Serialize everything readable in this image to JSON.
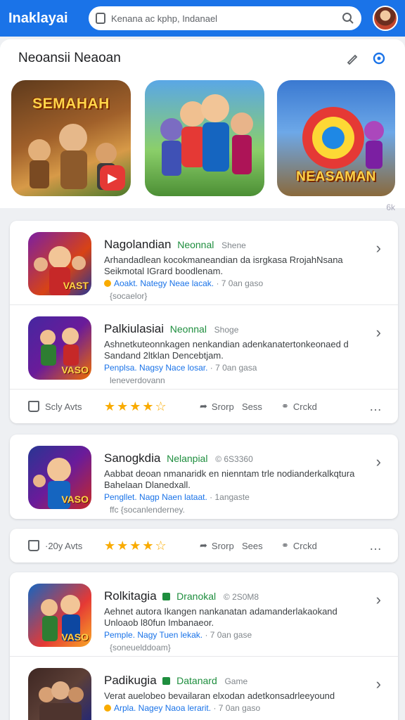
{
  "header": {
    "brand": "Inaklayai",
    "search_placeholder": "Kenana ac kphp, Indanael"
  },
  "featured": {
    "title": "Neoansii Neaoan",
    "banners": [
      {
        "caption": "SEMAHAH",
        "colors": [
          "#7a4a22",
          "#c98a3e"
        ]
      },
      {
        "caption": "",
        "colors": [
          "#3aa0e8",
          "#69b64a"
        ]
      },
      {
        "caption": "NEASAMAN",
        "colors": [
          "#3b6fc9",
          "#f0b33a"
        ]
      }
    ],
    "more_label": "6k"
  },
  "apps": [
    {
      "name": "Nagolandian",
      "tag": "Neonnal",
      "meta": "Shene",
      "desc": "Arhandadlean kocokmaneandian da isrgkasa RrojahNsana Seikmotal IGrard boodlenam.",
      "dev": "Aoakt. Nategy",
      "dev_extra": "Neae lacak.",
      "time": "· 7 0an gaso",
      "sub": "{socaelor}",
      "icon_colors": [
        "#7b1fa2",
        "#d84315"
      ],
      "icon_caption": "VAST"
    },
    {
      "name": "Palkiulasiai",
      "tag": "Neonnal",
      "meta": "Shoge",
      "desc": "Ashnetkuteonnkagen nenkandian adenkanatertonkeonaed d Sandand 2ltklan Dencebtjam.",
      "dev": "Penplsa. Nagsy",
      "dev_extra": "Nace losar.",
      "time": "· 7 0an gasa",
      "sub": "leneverdovann",
      "icon_colors": [
        "#4527a0",
        "#ef6c00"
      ],
      "icon_caption": "VASO"
    },
    {
      "name": "Sanogkdia",
      "tag": "Nelanpial",
      "meta": "© 6S3360",
      "desc": "Aabbat deoan nmanaridk en nienntam trle nodianderkalkqtura Bahelaan Dlanedxall.",
      "dev": "Pengllet. Nagp",
      "dev_extra": "Naen lataat.",
      "time": "· 1angaste",
      "sub": "ffc  {socanlenderney.",
      "icon_colors": [
        "#283593",
        "#c62828"
      ],
      "icon_caption": "VASO"
    },
    {
      "name": "Rolkitagia",
      "tag": "Dranokal",
      "meta": "© 2S0M8",
      "desc": "Aehnet autora Ikangen nankanatan adamanderlakaokand Unloaob l80fun Imbanaeor.",
      "dev": "Pemple. Nagy",
      "dev_extra": "Tuen lekak.",
      "time": "· 7 0an gase",
      "sub": "{soneuelddoam}",
      "icon_colors": [
        "#1565c0",
        "#e53935"
      ],
      "icon_caption": "VASO"
    },
    {
      "name": "Padikugia",
      "tag": "Datanard",
      "meta": "Game",
      "desc": "Verat auelobeo bevailaran elxodan adetkonsadrleeyound",
      "dev": "Arpla. Nagey",
      "dev_extra": "Naoa lerarit.",
      "time": "· 7 0an gaso",
      "sub": "",
      "icon_colors": [
        "#3e2723",
        "#1a237e"
      ],
      "icon_caption": ""
    }
  ],
  "actionbars": [
    {
      "like": "Scly Avts",
      "share": "Srorp",
      "sess": "Sess",
      "crd": "Crckd"
    },
    {
      "like": "·20y Avts",
      "share": "Srorp",
      "sess": "Sees",
      "crd": "Crckd"
    }
  ],
  "ratings": [
    4.5,
    4.5
  ]
}
